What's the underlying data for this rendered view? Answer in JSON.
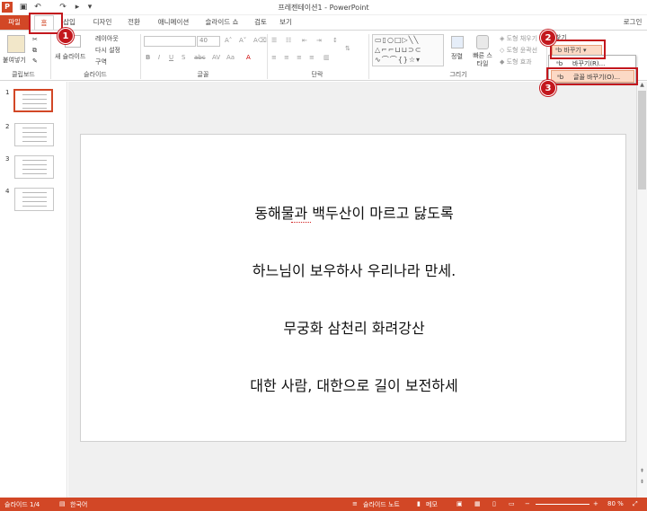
{
  "window": {
    "title": "프레젠테이션1 - PowerPoint"
  },
  "tabs": [
    {
      "label": "파일"
    },
    {
      "label": "홈"
    },
    {
      "label": "삽입"
    },
    {
      "label": "디자인"
    },
    {
      "label": "전환"
    },
    {
      "label": "애니메이션"
    },
    {
      "label": "슬라이드 쇼"
    },
    {
      "label": "검토"
    },
    {
      "label": "보기"
    },
    {
      "label": "로그인"
    }
  ],
  "ribbon": {
    "clipboard": {
      "paste": "붙여넣기",
      "group": "클립보드"
    },
    "slides": {
      "new_slide": "새 슬라이드",
      "layout": "레이아웃",
      "reset": "다시 설정",
      "section": "구역",
      "group": "슬라이드"
    },
    "font": {
      "size": "40",
      "group": "글꼴"
    },
    "paragraph": {
      "group": "단락"
    },
    "drawing": {
      "arrange": "정렬",
      "quick_styles": "빠른 스타일",
      "fill": "도형 채우기",
      "outline": "도형 윤곽선",
      "effects": "도형 효과",
      "group": "그리기"
    },
    "editing": {
      "find": "찾기",
      "replace": "바꾸기"
    }
  },
  "replace_menu": {
    "items": [
      "바꾸기(R)...",
      "글꼴 바꾸기(O)..."
    ]
  },
  "thumbnails": [
    "1",
    "2",
    "3",
    "4"
  ],
  "slide": {
    "lines": [
      "동해물과 백두산이 마르고 닳도록",
      "하느님이 보우하사 우리나라 만세.",
      "무궁화 삼천리 화려강산",
      "대한 사람, 대한으로 길이 보전하세"
    ]
  },
  "status": {
    "slide": "슬라이드 1/4",
    "language": "한국어",
    "notes": "슬라이드 노트",
    "comments": "메모",
    "zoom": "80 %"
  },
  "callouts": [
    "1",
    "2",
    "3"
  ],
  "colors": {
    "accent": "#d24726",
    "callout": "#c3171d"
  }
}
